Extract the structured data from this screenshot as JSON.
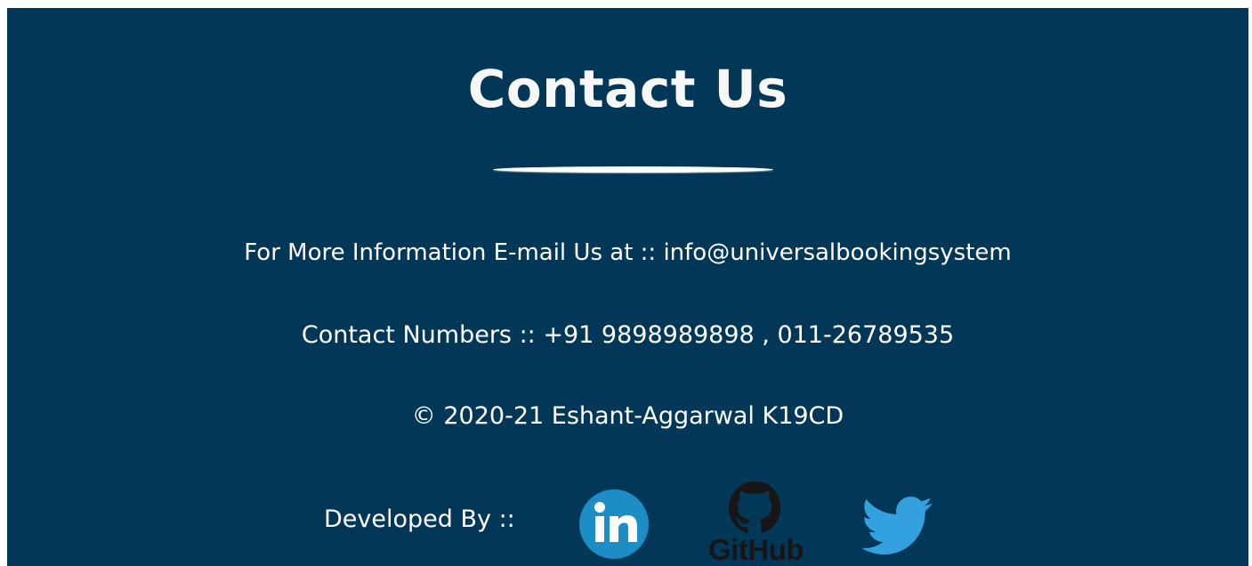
{
  "contact": {
    "title": "Contact Us",
    "email_line": "For More Information E-mail Us at :: info@universalbookingsystem",
    "phone_line": "Contact Numbers :: +91 9898989898 , 011-26789535",
    "copyright": "© 2020-21 Eshant-Aggarwal K19CD",
    "developed_by": "Developed By ::",
    "social": {
      "linkedin_icon": "linkedin-icon",
      "github_icon": "github-icon",
      "github_text": "GitHub",
      "twitter_icon": "twitter-icon"
    }
  },
  "colors": {
    "background": "#033757",
    "text": "#ffffff",
    "linkedin": "#1d8dc6",
    "github": "#171515",
    "twitter": "#33a1dd"
  }
}
